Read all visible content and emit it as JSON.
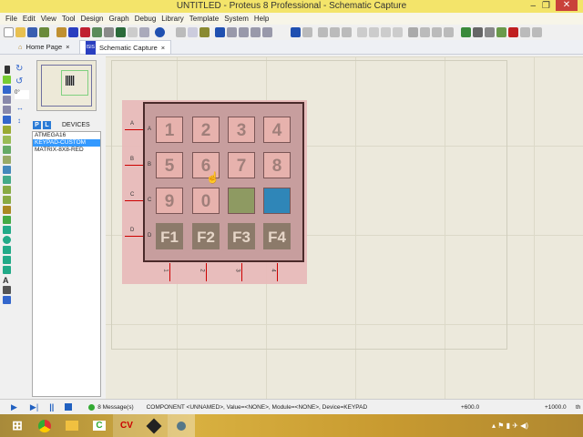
{
  "window": {
    "title": "UNTITLED - Proteus 8 Professional - Schematic Capture"
  },
  "menu": [
    "File",
    "Edit",
    "View",
    "Tool",
    "Design",
    "Graph",
    "Debug",
    "Library",
    "Template",
    "System",
    "Help"
  ],
  "tabs": [
    {
      "label": "Home Page",
      "close": "×"
    },
    {
      "label": "Schematic Capture",
      "close": "×"
    }
  ],
  "side": {
    "rotation": "0°",
    "p_label": "P",
    "l_label": "L",
    "devices_header": "DEVICES",
    "devices": [
      "ATMEGA16",
      "KEYPAD-CUSTOM",
      "MATRIX-8X8-RED"
    ],
    "selected_device": 1
  },
  "keypad": {
    "rows": [
      "A",
      "B",
      "C",
      "D"
    ],
    "columns": [
      "1",
      "2",
      "3",
      "4"
    ],
    "keys": [
      [
        "1",
        "2",
        "3",
        "4"
      ],
      [
        "5",
        "6",
        "7",
        "8"
      ],
      [
        "9",
        "0",
        "",
        ""
      ],
      [
        "F1",
        "F2",
        "F3",
        "F4"
      ]
    ],
    "special_key_colors": [
      "#8e9a62",
      "#2f86b8"
    ]
  },
  "status": {
    "messages": "8 Message(s)",
    "info": "COMPONENT <UNNAMED>, Value=<NONE>, Module=<NONE>, Device=KEYPAD",
    "x_coord": "+600.0",
    "y_coord": "+1000.0",
    "unit": "th"
  },
  "taskbar": {
    "apps": [
      "windows-start",
      "chrome",
      "file-explorer",
      "camtasia",
      "cvavr",
      "proteus-isis",
      "proteus-app"
    ]
  }
}
